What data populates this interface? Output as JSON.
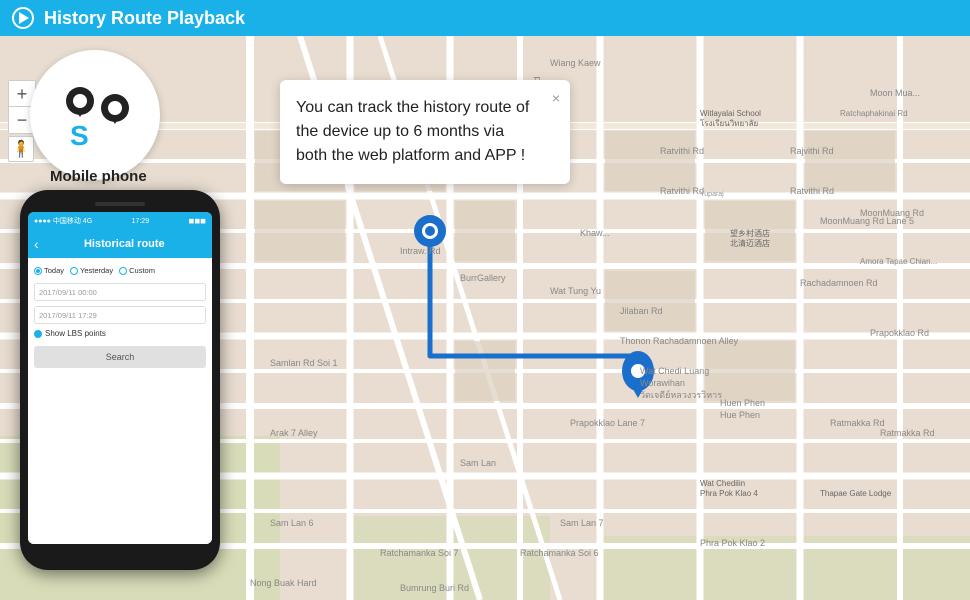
{
  "header": {
    "title": "History Route Playback",
    "play_icon": "▶"
  },
  "map": {
    "background_color": "#e8e0d8",
    "route_color": "#1a6fcd",
    "zoom_plus": "+",
    "zoom_minus": "−"
  },
  "popup": {
    "text": "You can track the history route of the device up to 6 months via both the web platform and APP !",
    "close": "×"
  },
  "phone": {
    "status_left": "●●●● 中国移动  4G",
    "status_time": "17:29",
    "status_right": "◼◼◼",
    "nav_back": "‹",
    "nav_title": "Historical route",
    "radio_options": [
      "Today",
      "Yesterday",
      "Custom"
    ],
    "input1": "2017/09/11 00:00",
    "input2": "2017/09/11 17:29",
    "checkbox_label": "Show LBS points",
    "search_label": "Search"
  },
  "mobile_phone_label": "Mobile phone",
  "gps": {
    "letter": "S",
    "pin_color": "#222"
  }
}
